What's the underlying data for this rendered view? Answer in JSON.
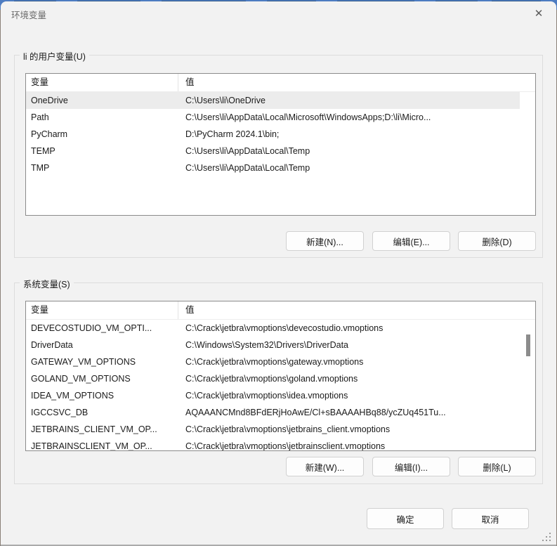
{
  "dialog": {
    "title": "环境变量",
    "close_icon": "✕"
  },
  "user_section": {
    "label": "li 的用户变量(U)",
    "table": {
      "headers": [
        "变量",
        "值"
      ],
      "rows": [
        {
          "name": "OneDrive",
          "value": "C:\\Users\\li\\OneDrive",
          "selected": true
        },
        {
          "name": "Path",
          "value": "C:\\Users\\li\\AppData\\Local\\Microsoft\\WindowsApps;D:\\li\\Micro..."
        },
        {
          "name": "PyCharm",
          "value": "D:\\PyCharm 2024.1\\bin;"
        },
        {
          "name": "TEMP",
          "value": "C:\\Users\\li\\AppData\\Local\\Temp"
        },
        {
          "name": "TMP",
          "value": "C:\\Users\\li\\AppData\\Local\\Temp"
        }
      ]
    },
    "buttons": {
      "new": "新建(N)...",
      "edit": "编辑(E)...",
      "delete": "删除(D)"
    }
  },
  "system_section": {
    "label": "系统变量(S)",
    "table": {
      "headers": [
        "变量",
        "值"
      ],
      "rows": [
        {
          "name": "DEVECOSTUDIO_VM_OPTI...",
          "value": "C:\\Crack\\jetbra\\vmoptions\\devecostudio.vmoptions"
        },
        {
          "name": "DriverData",
          "value": "C:\\Windows\\System32\\Drivers\\DriverData"
        },
        {
          "name": "GATEWAY_VM_OPTIONS",
          "value": "C:\\Crack\\jetbra\\vmoptions\\gateway.vmoptions"
        },
        {
          "name": "GOLAND_VM_OPTIONS",
          "value": "C:\\Crack\\jetbra\\vmoptions\\goland.vmoptions"
        },
        {
          "name": "IDEA_VM_OPTIONS",
          "value": "C:\\Crack\\jetbra\\vmoptions\\idea.vmoptions"
        },
        {
          "name": "IGCCSVC_DB",
          "value": "AQAAANCMnd8BFdERjHoAwE/Cl+sBAAAAHBq88/ycZUq451Tu..."
        },
        {
          "name": "JETBRAINS_CLIENT_VM_OP...",
          "value": "C:\\Crack\\jetbra\\vmoptions\\jetbrains_client.vmoptions"
        },
        {
          "name": "JETBRAINSCLIENT_VM_OP...",
          "value": "C:\\Crack\\jetbra\\vmoptions\\jetbrainsclient.vmoptions"
        }
      ]
    },
    "buttons": {
      "new": "新建(W)...",
      "edit": "编辑(I)...",
      "delete": "删除(L)"
    }
  },
  "footer": {
    "ok": "确定",
    "cancel": "取消"
  },
  "colors": {
    "backdrop_blue": "#4d7cc2",
    "dialog_bg": "#f2f2f2",
    "selected_row": "#ececec",
    "listview_border": "#8b8b8b",
    "button_border": "#d1d1d1"
  }
}
